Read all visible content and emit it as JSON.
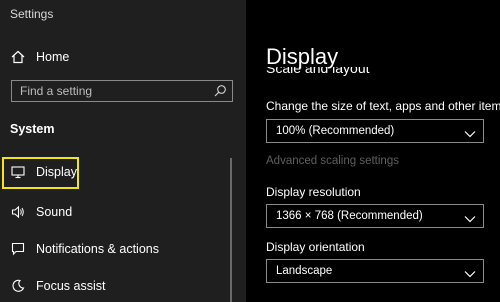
{
  "app": {
    "title": "Settings"
  },
  "sidebar": {
    "home_label": "Home",
    "search_placeholder": "Find a setting",
    "section_label": "System",
    "items": [
      {
        "label": "Display",
        "icon": "monitor-icon",
        "selected": true
      },
      {
        "label": "Sound",
        "icon": "speaker-icon"
      },
      {
        "label": "Notifications & actions",
        "icon": "message-icon"
      },
      {
        "label": "Focus assist",
        "icon": "moon-icon"
      }
    ]
  },
  "main": {
    "title": "Display",
    "section_header": "Scale and layout",
    "scale_label": "Change the size of text, apps and other items",
    "scale_value": "100% (Recommended)",
    "advanced_scaling_link": "Advanced scaling settings",
    "resolution_label": "Display resolution",
    "resolution_value": "1366 × 768 (Recommended)",
    "orientation_label": "Display orientation",
    "orientation_value": "Landscape"
  },
  "colors": {
    "sidebar_bg": "#1f1f1f",
    "main_bg": "#000000",
    "highlight": "#f2e60a",
    "disabled_text": "#5f5f5f"
  }
}
